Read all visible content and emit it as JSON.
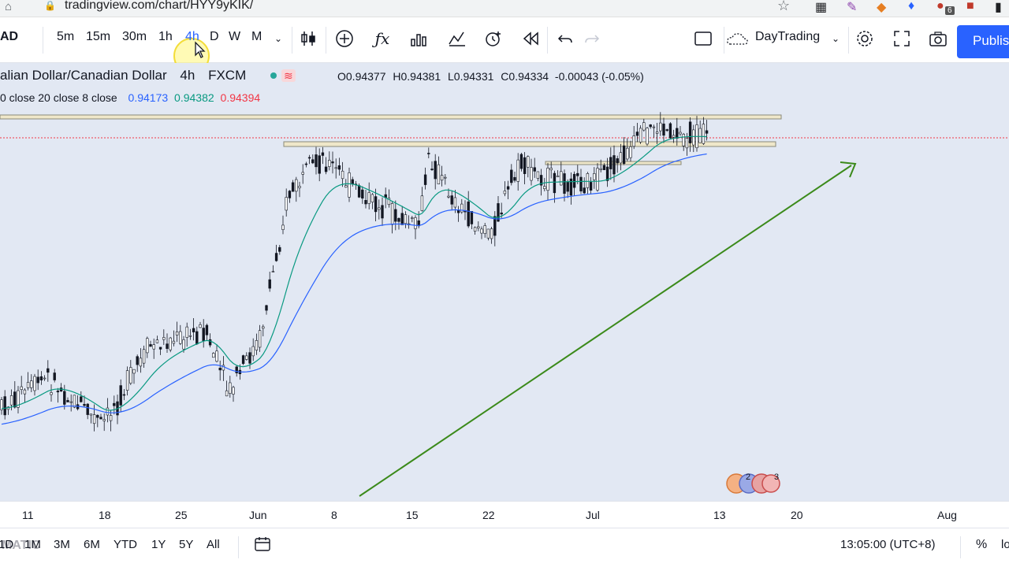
{
  "browser": {
    "url": "tradingview.com/chart/HYY9yKIK/",
    "extension_badge": "6"
  },
  "toolbar": {
    "symbol": "AD",
    "intervals": [
      "5m",
      "15m",
      "30m",
      "1h",
      "4h",
      "D",
      "W",
      "M"
    ],
    "active_interval": "4h",
    "layout_name": "DayTrading",
    "publish_label": "Publis"
  },
  "legend": {
    "symbol_name": "alian Dollar/Canadian Dollar",
    "interval": "4h",
    "exchange": "FXCM",
    "open": "O0.94377",
    "high": "H0.94381",
    "low": "L0.94331",
    "close": "C0.94334",
    "change": "-0.00043 (-0.05%)",
    "indicator_label": "0 close 20 close 8 close",
    "indicator_values": [
      "0.94173",
      "0.94382",
      "0.94394"
    ],
    "indicator_colors": [
      "#2962ff",
      "#089981",
      "#f23645"
    ]
  },
  "xaxis": {
    "labels": [
      "11",
      "18",
      "25",
      "Jun",
      "8",
      "15",
      "22",
      "Jul",
      "13",
      "20",
      "Aug"
    ]
  },
  "bottom": {
    "ranges": [
      "1D",
      "1M",
      "3M",
      "6M",
      "YTD",
      "1Y",
      "5Y",
      "All"
    ],
    "time": "13:05:00 (UTC+8)",
    "percent": "%",
    "log": "lo",
    "watermark": "MATIC"
  },
  "badges": {
    "left_count": "2",
    "right_count": "3"
  },
  "colors": {
    "accent": "#2962ff",
    "chart_bg": "#e2e8f3",
    "green_ma": "#089981",
    "blue_ma": "#2962ff",
    "trend_arrow": "#3b8a1a"
  }
}
